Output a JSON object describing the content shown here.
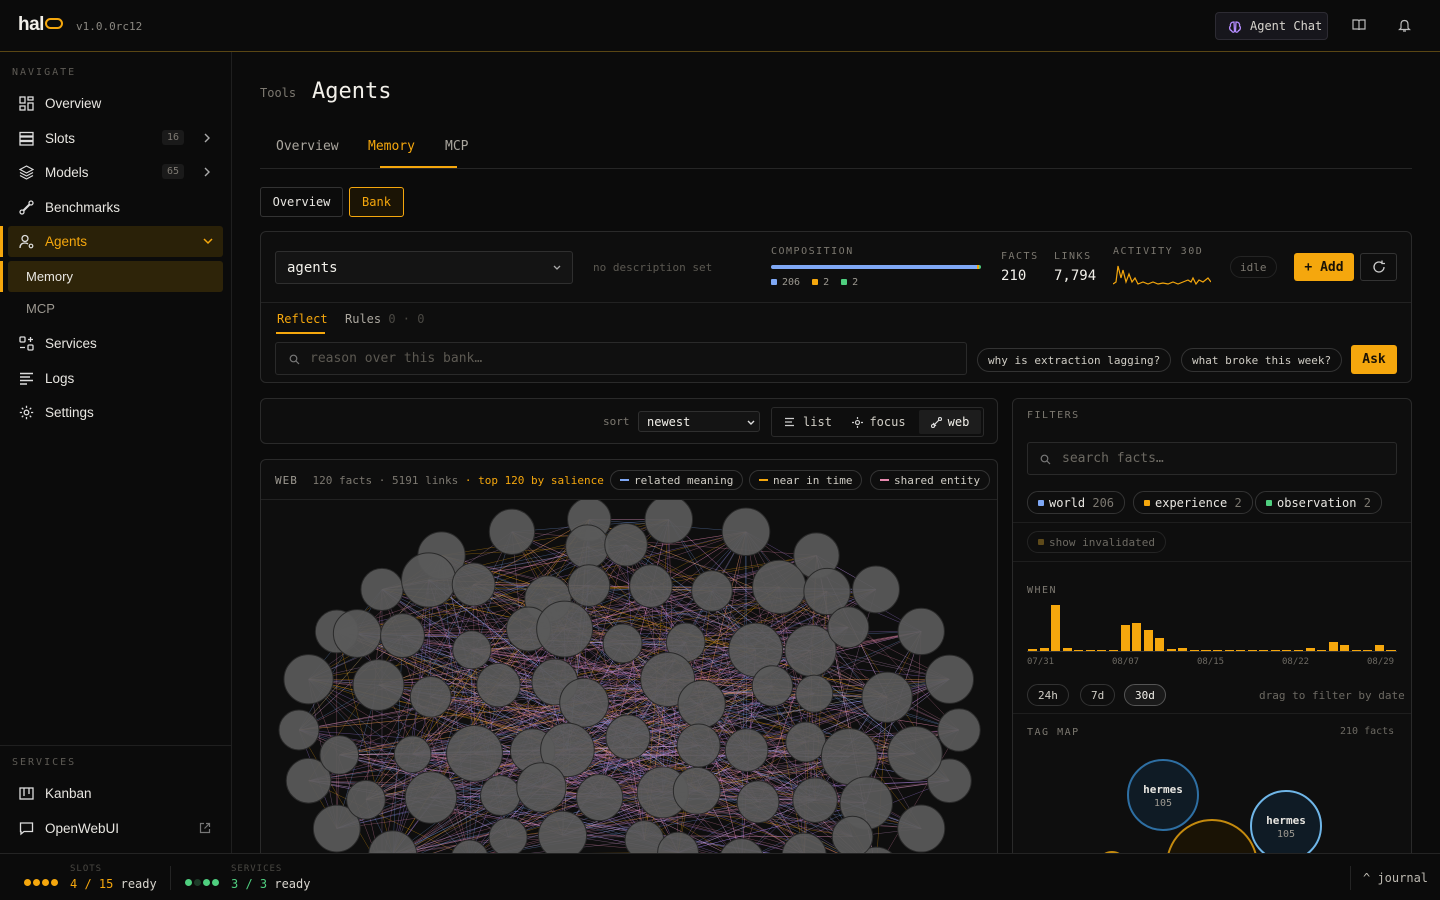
{
  "app": {
    "logo": "hal",
    "version": "v1.0.0rc12"
  },
  "topbar": {
    "agent_chat": "Agent Chat",
    "icons": [
      "book-icon",
      "bell-icon"
    ]
  },
  "sidebar": {
    "navigate_heading": "NAVIGATE",
    "items": [
      {
        "label": "Overview",
        "icon": "grid-icon"
      },
      {
        "label": "Slots",
        "icon": "server-icon",
        "badge": "16"
      },
      {
        "label": "Models",
        "icon": "layers-icon",
        "badge": "65"
      },
      {
        "label": "Benchmarks",
        "icon": "route-icon"
      },
      {
        "label": "Agents",
        "icon": "user-cog-icon"
      },
      {
        "label": "Services",
        "icon": "services-icon"
      },
      {
        "label": "Logs",
        "icon": "logs-icon"
      },
      {
        "label": "Settings",
        "icon": "gear-icon"
      }
    ],
    "sub_items": [
      {
        "label": "Memory"
      },
      {
        "label": "MCP"
      }
    ],
    "services_heading": "SERVICES",
    "services": [
      {
        "label": "Kanban",
        "icon": "kanban-icon"
      },
      {
        "label": "OpenWebUI",
        "icon": "chat-icon"
      }
    ]
  },
  "status": {
    "slots_label": "SLOTS",
    "slots_count": "4 / 15",
    "slots_state": "ready",
    "services_label": "SERVICES",
    "services_count": "3 / 3",
    "services_state": "ready",
    "journal": "^ journal"
  },
  "page": {
    "breadcrumb": "Tools",
    "title": "Agents",
    "tabs": [
      {
        "label": "Overview"
      },
      {
        "label": "Memory"
      },
      {
        "label": "MCP"
      }
    ],
    "subtabs": [
      {
        "label": "Overview"
      },
      {
        "label": "Bank"
      }
    ]
  },
  "bank": {
    "selected": "agents",
    "description": "no description set",
    "composition_label": "COMPOSITION",
    "composition": [
      {
        "value": "206",
        "color": "#7fa8f5"
      },
      {
        "value": "2",
        "color": "#f5a70d"
      },
      {
        "value": "2",
        "color": "#4fcf7f"
      }
    ],
    "facts_label": "FACTS",
    "facts": "210",
    "links_label": "LINKS",
    "links": "7,794",
    "activity_label": "ACTIVITY 30D",
    "state": "idle",
    "add_label": "+ Add"
  },
  "reflect": {
    "tab_reflect": "Reflect",
    "tab_rules": "Rules",
    "rules_counts": "0 · 0",
    "placeholder": "reason over this bank…",
    "suggestions": [
      "why is extraction lagging?",
      "what broke this week?"
    ],
    "ask_label": "Ask"
  },
  "toolbar": {
    "sort_label": "sort",
    "sort_value": "newest",
    "views": [
      {
        "label": "list"
      },
      {
        "label": "focus"
      },
      {
        "label": "web"
      }
    ]
  },
  "web": {
    "label": "WEB",
    "summary": "120 facts · 5191 links",
    "salience": "· top 120 by salience",
    "legend": [
      {
        "label": "related meaning",
        "color": "#7fa8f5"
      },
      {
        "label": "near in time",
        "color": "#f5a70d"
      },
      {
        "label": "shared entity",
        "color": "#e88ab0"
      }
    ]
  },
  "filters": {
    "heading": "FILTERS",
    "search_placeholder": "search facts…",
    "types": [
      {
        "label": "world",
        "count": "206",
        "color": "#7fa8f5"
      },
      {
        "label": "experience",
        "count": "2",
        "color": "#f5a70d"
      },
      {
        "label": "observation",
        "count": "2",
        "color": "#4fcf7f"
      }
    ],
    "show_invalidated": "show invalidated",
    "when_label": "WHEN",
    "when_ticks": [
      "07/31",
      "08/07",
      "08/15",
      "08/22",
      "08/29"
    ],
    "when_bars": [
      2,
      3,
      44,
      3,
      1,
      1,
      1,
      1,
      25,
      27,
      20,
      12,
      2,
      3,
      1,
      1,
      1,
      1,
      1,
      1,
      1,
      1,
      1,
      1,
      3,
      1,
      9,
      6,
      1,
      1,
      6,
      1
    ],
    "ranges": [
      {
        "label": "24h"
      },
      {
        "label": "7d"
      },
      {
        "label": "30d"
      }
    ],
    "drag_hint": "drag to filter by date",
    "tagmap_label": "TAG MAP",
    "tagmap_count": "210 facts",
    "tags": [
      {
        "name": "hermes",
        "count": "105"
      },
      {
        "name": "hermes",
        "count": "105"
      }
    ]
  }
}
